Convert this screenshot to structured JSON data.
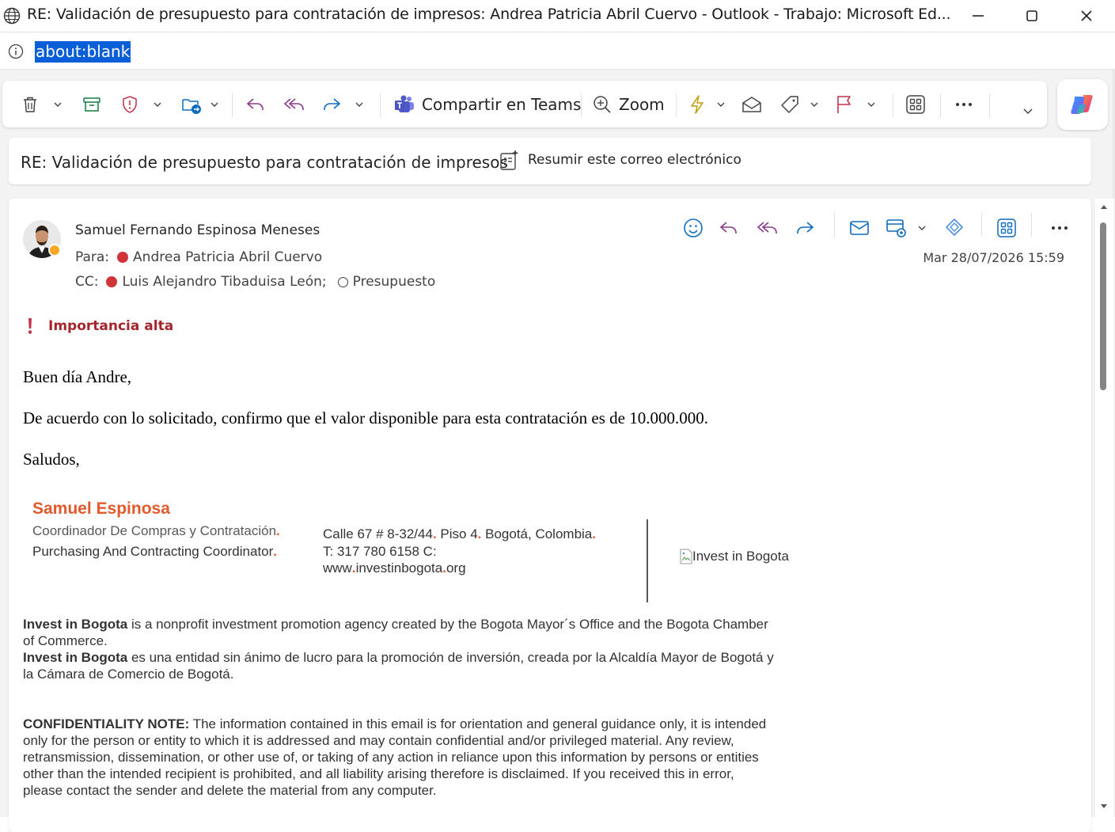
{
  "window": {
    "title": "RE: Validación de presupuesto para contratación de impresos: Andrea Patricia Abril Cuervo - Outlook - Trabajo: Microsoft Ed...",
    "controls": [
      "minimize-icon",
      "maximize-icon",
      "close-icon"
    ]
  },
  "address_bar": {
    "url": "about:blank",
    "icon": "info-icon"
  },
  "ribbon": {
    "teams_label": "Compartir en Teams",
    "zoom_label": "Zoom",
    "icons": [
      "delete-icon",
      "archive-icon",
      "report-icon",
      "move-icon",
      "reply-icon",
      "reply-all-icon",
      "forward-icon",
      "teams-icon",
      "zoom-icon",
      "quick-steps-icon",
      "read-unread-icon",
      "tag-icon",
      "flag-icon",
      "apps-icon",
      "more-icon",
      "expand-icon",
      "copilot-icon"
    ]
  },
  "subject_bar": {
    "subject": "RE: Validación de presupuesto para contratación de impresos",
    "summarize_label": "Resumir este correo electrónico"
  },
  "message": {
    "sender": "Samuel Fernando Espinosa Meneses",
    "to_label": "Para:",
    "to": "Andrea Patricia Abril Cuervo",
    "cc_label": "CC:",
    "cc": [
      "Luis Alejandro Tibaduisa León;",
      "Presupuesto"
    ],
    "date": "Mar 28/07/2026 15:59",
    "importance": "Importancia alta",
    "greeting": "Buen día Andre,",
    "body": "De acuerdo con lo solicitado, confirmo que el valor disponible para esta contratación es de 10.000.000.",
    "closing": "Saludos,"
  },
  "signature": {
    "name": "Samuel Espinosa",
    "role_es": "Coordinador De Compras y Contratación",
    "role_en": "Purchasing And Contracting Coordinator",
    "address_a": "Calle 67 # 8-32/44",
    "address_b": " Piso 4",
    "address_c": " Bogotá, Colombia",
    "phone": "T: 317 780 6158 C:",
    "web_a": "www",
    "web_b": "investinbogota",
    "web_c": "org",
    "image_alt": "Invest in Bogota",
    "dot": "."
  },
  "footer": {
    "org": "Invest in Bogota",
    "en_text": " is a nonprofit investment promotion agency created by the Bogota Mayor´s Office and the Bogota Chamber of Commerce.",
    "es_text": " es una entidad sin ánimo de lucro para la promoción de inversión, creada por la Alcaldía Mayor de Bogotá y la Cámara de Comercio de Bogotá.",
    "conf_label": "CONFIDENTIALITY NOTE:",
    "conf_text": " The information contained in this email is for orientation and general guidance only, it is intended only for the person or entity to which it is addressed and may contain confidential and/or privileged material. Any review, retransmission, dissemination, or other use of, or taking of any action in reliance upon this information by persons or entities other than the intended recipient is prohibited, and all liability arising therefore is disclaimed. If you received this in error, please contact the sender and delete the material from any computer."
  },
  "colors": {
    "accent_orange": "#e05a2b",
    "importance_red": "#a4262c",
    "url_highlight": "#0a5fd8",
    "presence_away": "#f7a823"
  }
}
